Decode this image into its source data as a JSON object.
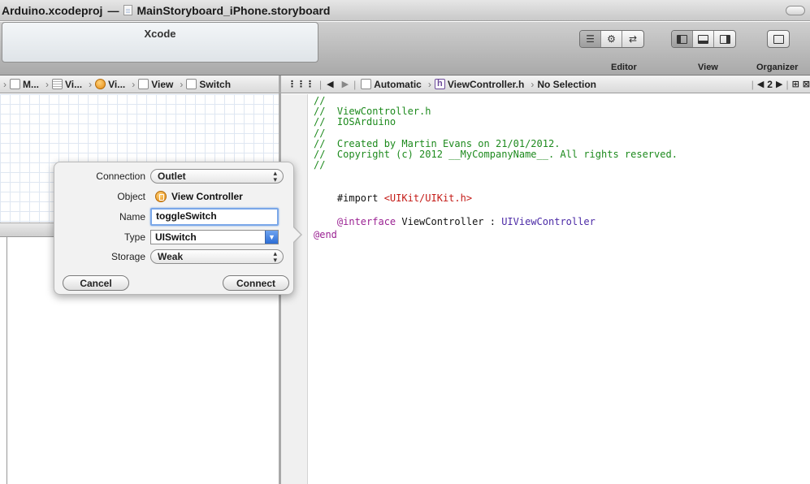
{
  "window": {
    "project": "Arduino.xcodeproj",
    "separator": "—",
    "document": "MainStoryboard_iPhone.storyboard"
  },
  "toolbar": {
    "activity_title": "Xcode",
    "editor_label": "Editor",
    "view_label": "View",
    "organizer_label": "Organizer"
  },
  "jumpbar_left": {
    "items": [
      "M...",
      "Vi...",
      "Vi...",
      "View",
      "Switch"
    ]
  },
  "jumpbar_right": {
    "mode": "Automatic",
    "file": "ViewController.h",
    "selection": "No Selection",
    "counter": "2"
  },
  "code_lines": [
    "//",
    "//  ViewController.h",
    "//  IOSArduino",
    "//",
    "//  Created by Martin Evans on 21/01/2012.",
    "//  Copyright (c) 2012 __MyCompanyName__. All rights reserved.",
    "//",
    "",
    "#import ",
    "<UIKit/UIKit.h>",
    "",
    "@interface",
    " ViewController : ",
    "UIViewController",
    "",
    "@end"
  ],
  "popover": {
    "connection_label": "Connection",
    "connection_value": "Outlet",
    "object_label": "Object",
    "object_value": "View Controller",
    "name_label": "Name",
    "name_value": "toggleSwitch",
    "type_label": "Type",
    "type_value": "UISwitch",
    "storage_label": "Storage",
    "storage_value": "Weak",
    "cancel_label": "Cancel",
    "connect_label": "Connect"
  }
}
